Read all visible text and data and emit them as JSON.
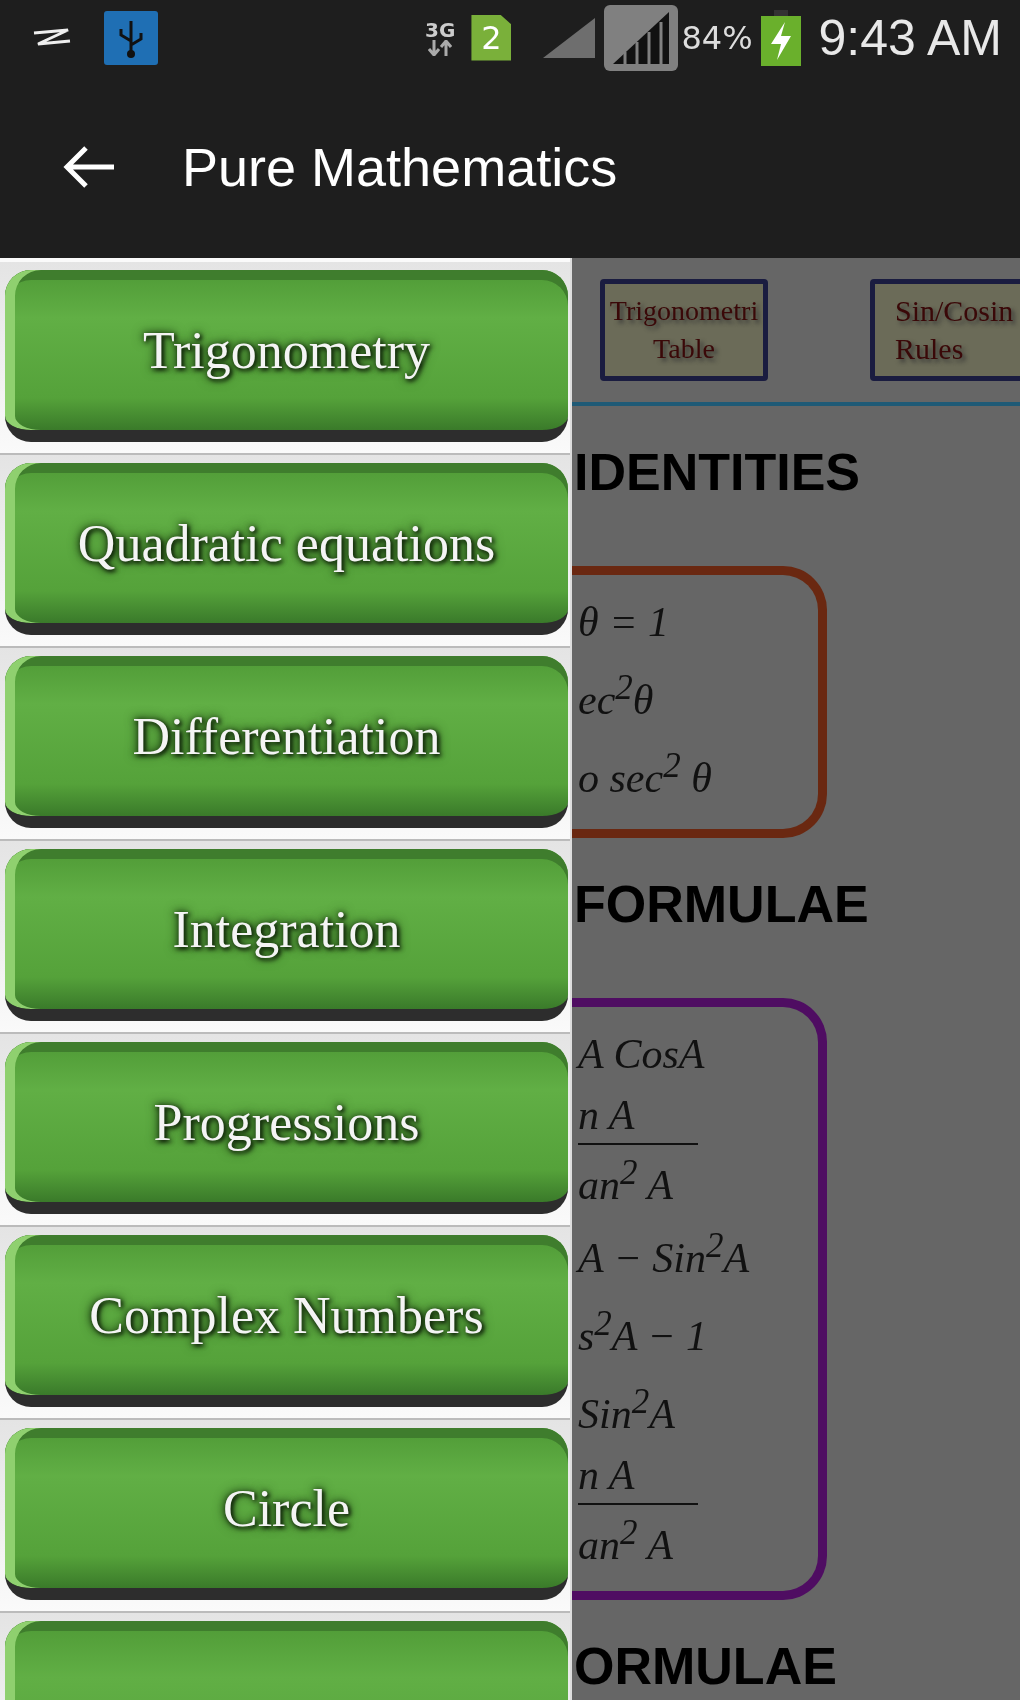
{
  "status_bar": {
    "network": "3G",
    "sim": "2",
    "battery": "84%",
    "time": "9:43 AM"
  },
  "app_bar": {
    "title": "Pure Mathematics"
  },
  "drawer": {
    "items": [
      {
        "kind": "button",
        "label": "Trigonometry"
      },
      {
        "kind": "button",
        "label": "Quadratic equations"
      },
      {
        "kind": "button",
        "label": "Differentiation"
      },
      {
        "kind": "button",
        "label": "Integration"
      },
      {
        "kind": "button",
        "label": "Progressions"
      },
      {
        "kind": "button",
        "label": "Complex Numbers"
      },
      {
        "kind": "button",
        "label": "Circle"
      },
      {
        "kind": "partial"
      }
    ]
  },
  "content": {
    "tabs": [
      {
        "lines": [
          "Trigonometri",
          "Table"
        ]
      },
      {
        "lines": [
          "Sin/Cosin",
          "Rules"
        ]
      }
    ],
    "sections": [
      {
        "heading": "IDENTITIES",
        "color": "#6a2811",
        "lines": [
          {
            "kind": "text",
            "text": "θ = 1"
          },
          {
            "kind": "text",
            "text": "ec$^{2}$θ"
          },
          {
            "kind": "text",
            "text": "o sec$^{2}$ θ"
          }
        ]
      },
      {
        "heading": "FORMULAE",
        "color": "#4f0d62",
        "lines": [
          {
            "kind": "text",
            "text": "A  CosA"
          },
          {
            "kind": "fraction",
            "numerator": "n A",
            "denominator": "an$^{2}$ A"
          },
          {
            "kind": "text",
            "text": "A − Sin$^{2}$A"
          },
          {
            "kind": "text",
            "text": "s$^{2}$A − 1"
          },
          {
            "kind": "text",
            "text": "Sin$^{2}$A"
          },
          {
            "kind": "fraction",
            "numerator": "n A",
            "denominator": "an$^{2}$ A"
          }
        ]
      },
      {
        "heading": "ORMULAE"
      }
    ]
  }
}
